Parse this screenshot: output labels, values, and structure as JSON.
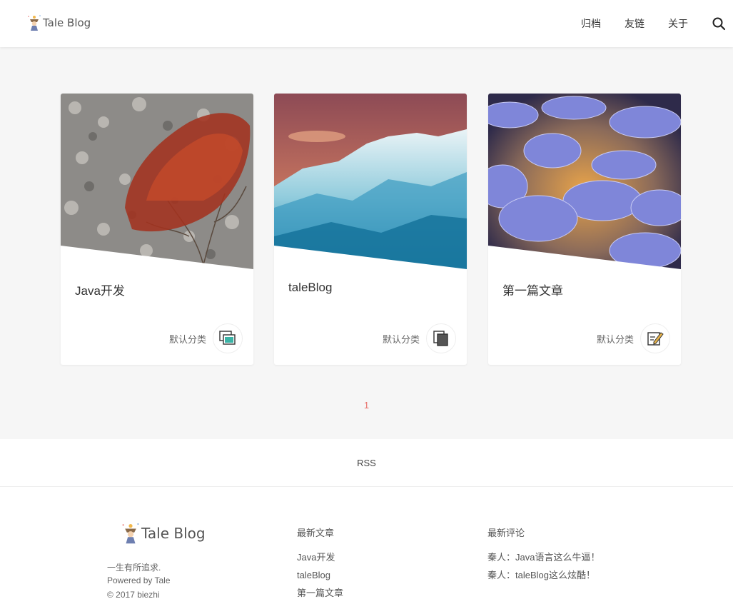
{
  "header": {
    "brand": "Tale Blog",
    "nav": [
      "归档",
      "友链",
      "关于"
    ]
  },
  "posts": [
    {
      "title": "Java开发",
      "category": "默认分类",
      "badge_icon": "gallery-icon"
    },
    {
      "title": "taleBlog",
      "category": "默认分类",
      "badge_icon": "copy-icon"
    },
    {
      "title": "第一篇文章",
      "category": "默认分类",
      "badge_icon": "edit-icon"
    }
  ],
  "pagination": {
    "current": "1"
  },
  "rss": "RSS",
  "footer": {
    "brand": "Tale Blog",
    "tagline": "一生有所追求.",
    "powered": "Powered by Tale",
    "copyright": "© 2017 biezhi",
    "latest_posts_title": "最新文章",
    "latest_posts": [
      "Java开发",
      "taleBlog",
      "第一篇文章"
    ],
    "latest_comments_title": "最新评论",
    "latest_comments": [
      "秦人：Java语言这么牛逼！",
      "秦人：taleBlog这么炫酷！"
    ]
  },
  "colors": {
    "accent": "#e8716b",
    "background": "#f6f6f6"
  }
}
